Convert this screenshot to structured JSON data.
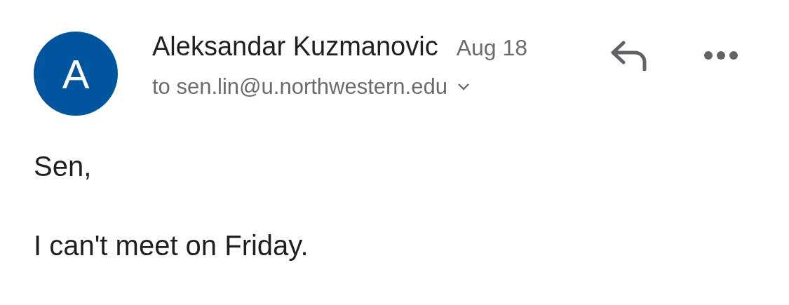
{
  "sender": {
    "initial": "A",
    "name": "Aleksandar Kuzmanovic",
    "date": "Aug 18",
    "recipient": "to sen.lin@u.northwestern.edu"
  },
  "body": [
    "Sen,",
    "I can't meet on Friday."
  ]
}
